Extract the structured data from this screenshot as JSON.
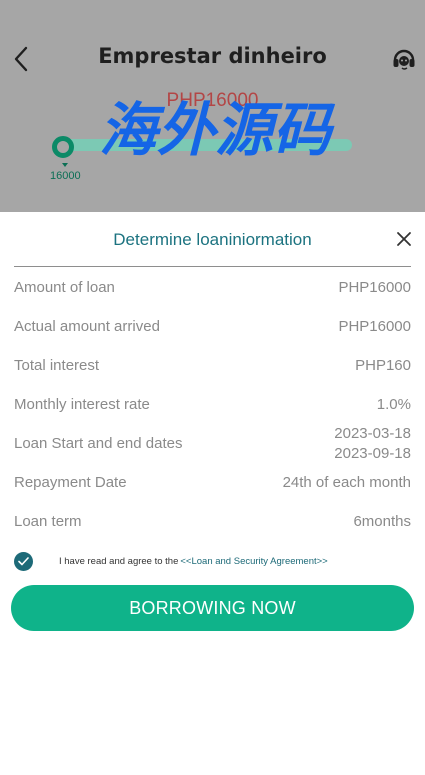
{
  "header": {
    "title": "Emprestar dinheiro",
    "back_icon": "chevron-left-icon",
    "support_icon": "headset-icon"
  },
  "background": {
    "amount_display": "PHP16000",
    "slider_min": "16000",
    "slider_value_fraction": 0.0,
    "watermark_text": "海外源码"
  },
  "modal": {
    "title": "Determine loaniniormation",
    "close_icon": "close-icon",
    "rows": [
      {
        "label": "Amount of loan",
        "value": "PHP16000"
      },
      {
        "label": "Actual amount arrived",
        "value": "PHP16000"
      },
      {
        "label": "Total interest",
        "value": "PHP160"
      },
      {
        "label": "Monthly interest rate",
        "value": "1.0%"
      },
      {
        "label": "Loan Start and end dates",
        "value_start": "2023-03-18",
        "value_end": "2023-09-18"
      },
      {
        "label": "Repayment Date",
        "value": "24th of each month"
      },
      {
        "label": "Loan term",
        "value": "6months"
      }
    ],
    "agreement": {
      "checked": true,
      "text": "I have read and agree to the",
      "link": "<<Loan and Security Agreement>>"
    },
    "submit_label": "BORROWING NOW"
  },
  "colors": {
    "accent": "#0fb38a",
    "title_teal": "#1c7380",
    "check": "#1d6a78",
    "overlay": "#a6a6a6"
  }
}
